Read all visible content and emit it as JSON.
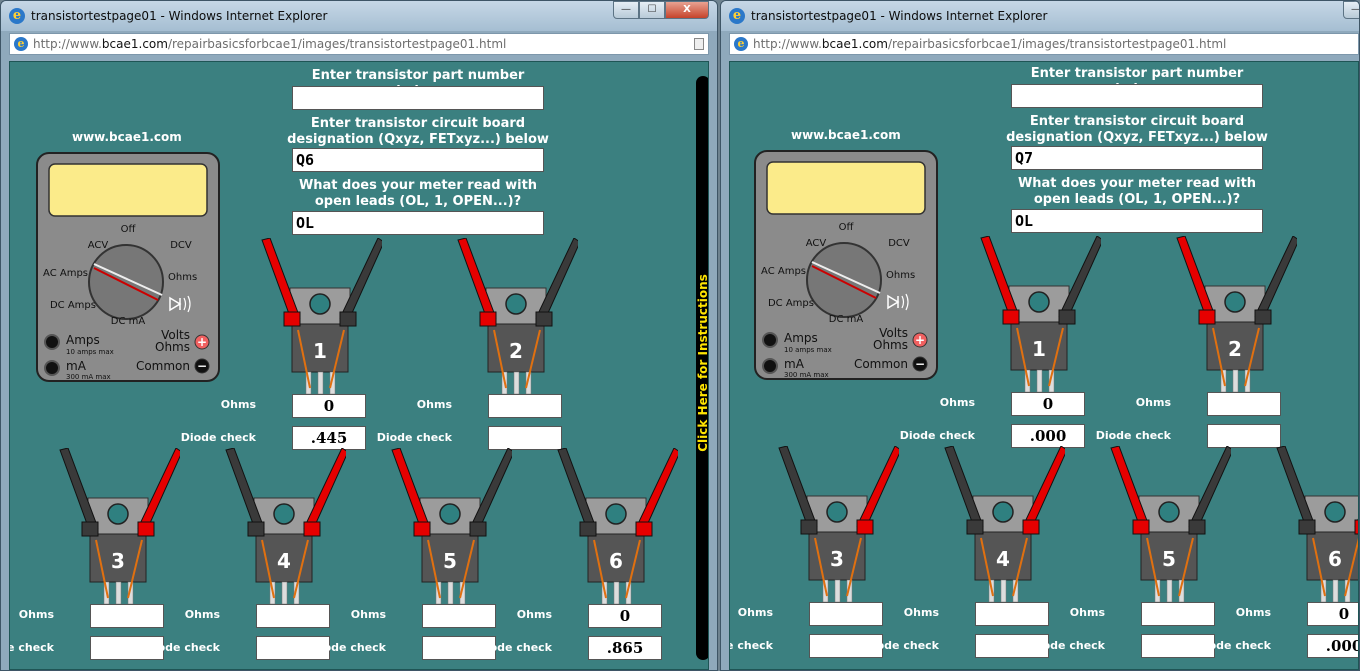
{
  "windows": [
    {
      "title": "transistortestpage01 - Windows Internet Explorer",
      "url_prefix": "http://www.",
      "url_domain": "bcae1.com",
      "url_path": "/repairbasicsforbcae1/images/transistortestpage01.html",
      "site": "www.bcae1.com",
      "part_label": "Enter transistor part number below",
      "part_value": "",
      "designation_label_1": "Enter transistor circuit board",
      "designation_label_2": "designation (Qxyz, FETxyz...) below",
      "designation_value": "Q6",
      "openleads_label_1": "What does your meter read with",
      "openleads_label_2": "open leads (OL, 1, OPEN...)?",
      "openleads_value": "OL",
      "sidebar_text": "Click Here for Instructions",
      "ohms_label": "Ohms",
      "diode_label": "Diode check",
      "tests": [
        {
          "num": "1",
          "ohms": "0",
          "diode": ".445",
          "probes": "red-black"
        },
        {
          "num": "2",
          "ohms": "",
          "diode": "",
          "probes": "red-black"
        },
        {
          "num": "3",
          "ohms": "",
          "diode": "",
          "probes": "black-red"
        },
        {
          "num": "4",
          "ohms": "",
          "diode": "",
          "probes": "black-red"
        },
        {
          "num": "5",
          "ohms": "",
          "diode": "",
          "probes": "red-black"
        },
        {
          "num": "6",
          "ohms": "0",
          "diode": ".865",
          "probes": "black-red"
        }
      ]
    },
    {
      "title": "transistortestpage01 - Windows Internet Explorer",
      "url_prefix": "http://www.",
      "url_domain": "bcae1.com",
      "url_path": "/repairbasicsforbcae1/images/transistortestpage01.html",
      "site": "www.bcae1.com",
      "part_label": "Enter transistor part number below",
      "part_value": "",
      "designation_label_1": "Enter transistor circuit board",
      "designation_label_2": "designation (Qxyz, FETxyz...) below",
      "designation_value": "Q7",
      "openleads_label_1": "What does your meter read with",
      "openleads_label_2": "open leads (OL, 1, OPEN...)?",
      "openleads_value": "OL",
      "ohms_label": "Ohms",
      "diode_label": "Diode check",
      "tests": [
        {
          "num": "1",
          "ohms": "0",
          "diode": ".000",
          "probes": "red-black"
        },
        {
          "num": "2",
          "ohms": "",
          "diode": "",
          "probes": "red-black"
        },
        {
          "num": "3",
          "ohms": "",
          "diode": "",
          "probes": "black-red"
        },
        {
          "num": "4",
          "ohms": "",
          "diode": "",
          "probes": "black-red"
        },
        {
          "num": "5",
          "ohms": "",
          "diode": "",
          "probes": "red-black"
        },
        {
          "num": "6",
          "ohms": "0",
          "diode": ".000",
          "probes": "black-red"
        }
      ]
    }
  ],
  "meter": {
    "dial": [
      "Off",
      "ACV",
      "DCV",
      "AC Amps",
      "Ohms",
      "DC Amps",
      "DC mA"
    ],
    "amps": "Amps",
    "amps_sub": "10 amps max",
    "ma": "mA",
    "ma_sub": "300 mA max",
    "volts": "Volts",
    "ohms": "Ohms",
    "common": "Common",
    "plus": "+",
    "minus": "−"
  },
  "window_buttons": {
    "min": "—",
    "max": "☐",
    "close": "X"
  },
  "colors": {
    "panel": "#3b8080",
    "probe_red": "#e60000",
    "probe_black": "#3a3a3a",
    "lcd": "#fbeb8a"
  }
}
